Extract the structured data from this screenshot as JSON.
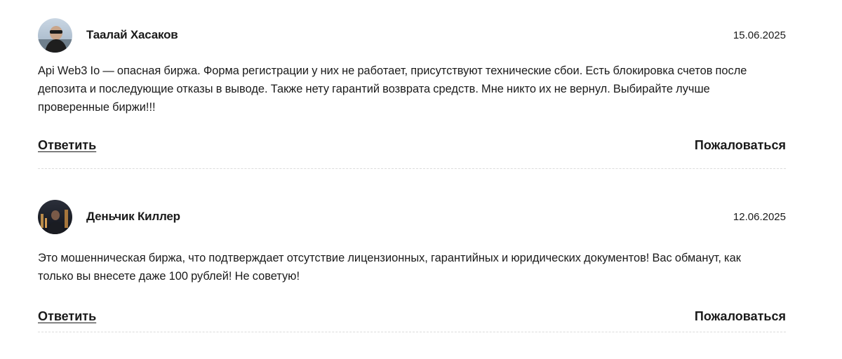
{
  "comments": [
    {
      "author": "Таалай Хасаков",
      "date": "15.06.2025",
      "text": "Api Web3 Io — опасная биржа. Форма регистрации у них не работает, присутствуют технические сбои. Есть блокировка счетов после\nдепозита и последующие отказы в выводе. Также нету гарантий возврата средств. Мне никто их не вернул. Выбирайте лучше\nпроверенные биржи!!!",
      "reply_label": "Ответить",
      "report_label": "Пожаловаться",
      "avatar_icon": "user-photo-avatar"
    },
    {
      "author": "Деньчик Киллер",
      "date": "12.06.2025",
      "text": "Это мошенническая биржа, что подтверждает отсутствие лицензионных, гарантийных и юридических документов! Вас обманут, как\nтолько вы внесете даже 100 рублей! Не советую!",
      "reply_label": "Ответить",
      "report_label": "Пожаловаться",
      "avatar_icon": "user-photo-avatar"
    }
  ]
}
